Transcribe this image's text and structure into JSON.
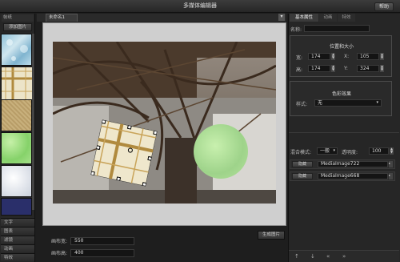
{
  "app": {
    "title": "多媒体编辑器",
    "help_label": "帮助"
  },
  "left_panel": {
    "header": "帖纸",
    "add_image_label": "添加图片",
    "categories": [
      "文字",
      "图表",
      "滤镜",
      "动画",
      "特效"
    ]
  },
  "canvas": {
    "tab_label": "未命名1",
    "width_label": "画布宽:",
    "width_value": "550",
    "height_label": "画布高:",
    "height_value": "400",
    "generate_label": "生成图片"
  },
  "right_panel": {
    "tabs": [
      "基本属性",
      "动画",
      "特效"
    ],
    "name_label": "名称:",
    "name_value": "",
    "position_size": {
      "title": "位置和大小",
      "width_label": "宽:",
      "width_value": "174",
      "height_label": "高:",
      "height_value": "174",
      "x_label": "X:",
      "x_value": "105",
      "y_label": "Y:",
      "y_value": "324"
    },
    "color_effect": {
      "title": "色彩效果",
      "style_label": "样式:",
      "style_value": "无"
    },
    "blend_label": "混合模式:",
    "blend_value": "一般",
    "opacity_label": "透明度:",
    "opacity_value": "100",
    "layers": [
      {
        "hide_label": "隐藏",
        "name": "MediaImage722"
      },
      {
        "hide_label": "隐藏",
        "name": "MediaImage668"
      }
    ]
  },
  "colors": {
    "accent": "#9ed38a",
    "panel_bg": "#262626",
    "stage_bg": "#cfcfcf"
  }
}
